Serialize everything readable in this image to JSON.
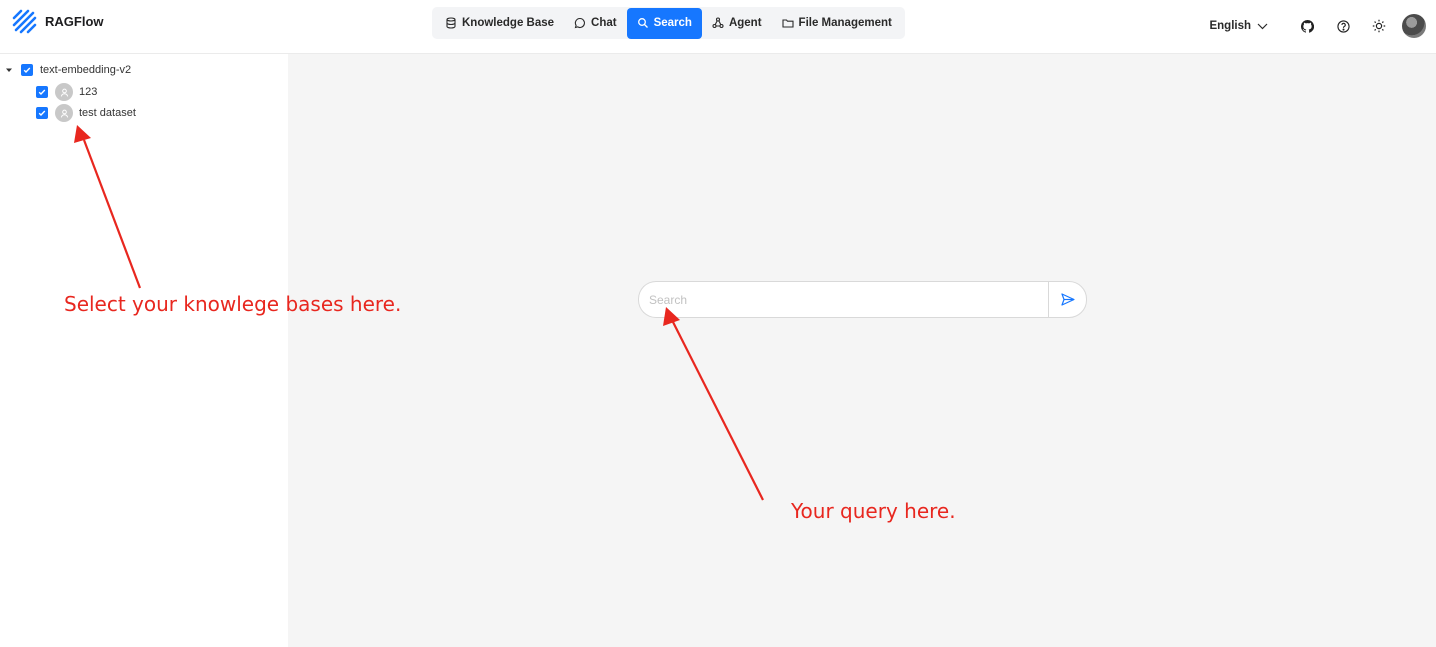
{
  "header": {
    "brand": "RAGFlow",
    "nav": [
      {
        "label": "Knowledge Base",
        "icon": "database-icon"
      },
      {
        "label": "Chat",
        "icon": "chat-bubble-icon"
      },
      {
        "label": "Search",
        "icon": "search-icon",
        "active": true
      },
      {
        "label": "Agent",
        "icon": "agent-graph-icon"
      },
      {
        "label": "File Management",
        "icon": "folder-icon"
      }
    ],
    "language": "English",
    "accent_color": "#1677ff"
  },
  "sidebar": {
    "root": {
      "label": "text-embedding-v2",
      "checked": true,
      "expanded": true
    },
    "items": [
      {
        "label": "123",
        "checked": true
      },
      {
        "label": "test dataset",
        "checked": true
      }
    ]
  },
  "search": {
    "placeholder": "Search",
    "value": ""
  },
  "annotations": {
    "left": "Select your knowlege bases here.",
    "right": "Your query here.",
    "color": "#e8271f"
  }
}
